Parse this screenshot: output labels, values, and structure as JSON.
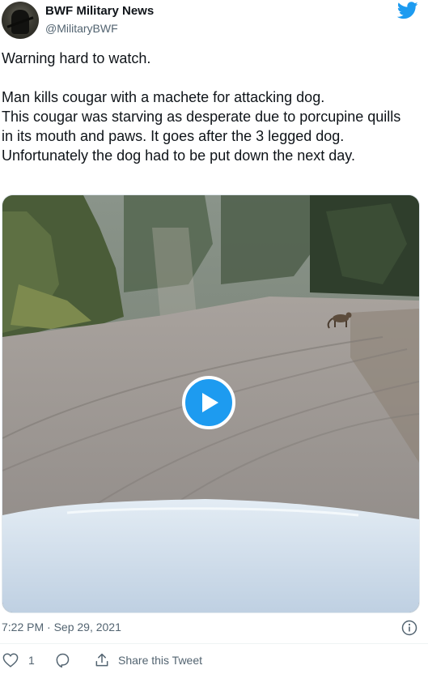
{
  "tweet": {
    "author_name": "BWF Military News",
    "author_handle": "@MilitaryBWF",
    "text": "Warning hard to watch.\n\nMan kills cougar with a machete for attacking dog.\nThis cougar was starving as desperate due to porcupine quills in its mouth and paws. It goes after the 3 legged dog. Unfortunately the dog had to be put down the next day.",
    "timestamp": "7:22 PM · Sep 29, 2021",
    "like_count": "1",
    "share_label": "Share this Tweet"
  },
  "icons": {
    "logo": "twitter-bird-icon",
    "play": "play-icon",
    "info": "info-icon",
    "like": "heart-icon",
    "reply": "reply-icon",
    "share": "share-icon"
  },
  "colors": {
    "accent": "#1d9bf0",
    "text_primary": "#0f1419",
    "text_secondary": "#536471"
  }
}
